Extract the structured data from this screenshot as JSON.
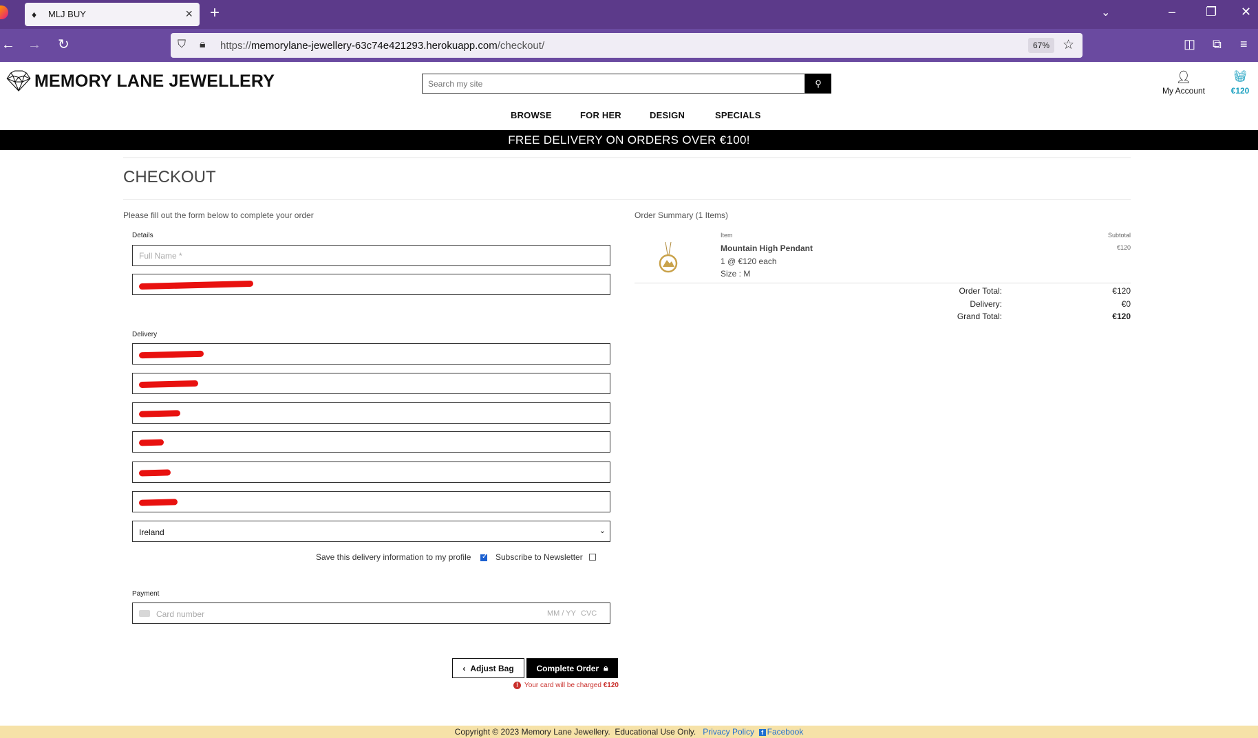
{
  "browser": {
    "tab_title": "MLJ BUY",
    "url_prefix": "https://",
    "url_host": "memorylane-jewellery-63c74e421293.herokuapp.com",
    "url_path": "/checkout/",
    "zoom": "67%"
  },
  "header": {
    "brand": "MEMORY LANE JEWELLERY",
    "search_placeholder": "Search my site",
    "account_label": "My Account",
    "bag_total": "€120"
  },
  "nav": {
    "items": [
      "BROWSE",
      "FOR HER",
      "DESIGN",
      "SPECIALS"
    ]
  },
  "banner": "FREE DELIVERY ON ORDERS OVER €100!",
  "checkout": {
    "title": "CHECKOUT",
    "intro": "Please fill out the form below to complete your order",
    "details_label": "Details",
    "full_name_placeholder": "Full Name *",
    "delivery_label": "Delivery",
    "country": "Ireland",
    "save_info_label": "Save this delivery information to my profile",
    "save_info_checked": true,
    "newsletter_label": "Subscribe to Newsletter",
    "newsletter_checked": false,
    "payment_label": "Payment",
    "card_placeholder": "Card number",
    "card_expiry_placeholder": "MM / YY",
    "card_cvc_placeholder": "CVC",
    "adjust_bag_label": "Adjust Bag",
    "complete_order_label": "Complete Order",
    "charge_note_prefix": "Your card will be charged",
    "charge_amount": "€120"
  },
  "summary": {
    "title": "Order Summary (1 Items)",
    "col_item": "Item",
    "col_subtotal": "Subtotal",
    "items": [
      {
        "name": "Mountain High Pendant",
        "qty_line": "1 @ €120 each",
        "size_line": "Size : M",
        "subtotal": "€120"
      }
    ],
    "order_total_label": "Order Total:",
    "order_total": "€120",
    "delivery_label": "Delivery:",
    "delivery": "€0",
    "grand_total_label": "Grand Total:",
    "grand_total": "€120"
  },
  "footer": {
    "copyright": "Copyright © 2023 Memory Lane Jewellery.",
    "edu_note": "Educational Use Only.",
    "privacy_link": "Privacy Policy",
    "facebook_link": "Facebook"
  },
  "colors": {
    "tabbar": "#5c3a8a",
    "navbar": "#6a4aa0",
    "accent_bag": "#1aa0c0",
    "footer_bg": "#f6e2a8",
    "redaction": "#e8110f",
    "warning": "#c9302c"
  },
  "icons": [
    "firefox-icon",
    "diamond-icon",
    "search-icon",
    "account-icon",
    "basket-icon",
    "lock-icon",
    "chevron-left-icon",
    "warning-icon",
    "facebook-icon"
  ]
}
